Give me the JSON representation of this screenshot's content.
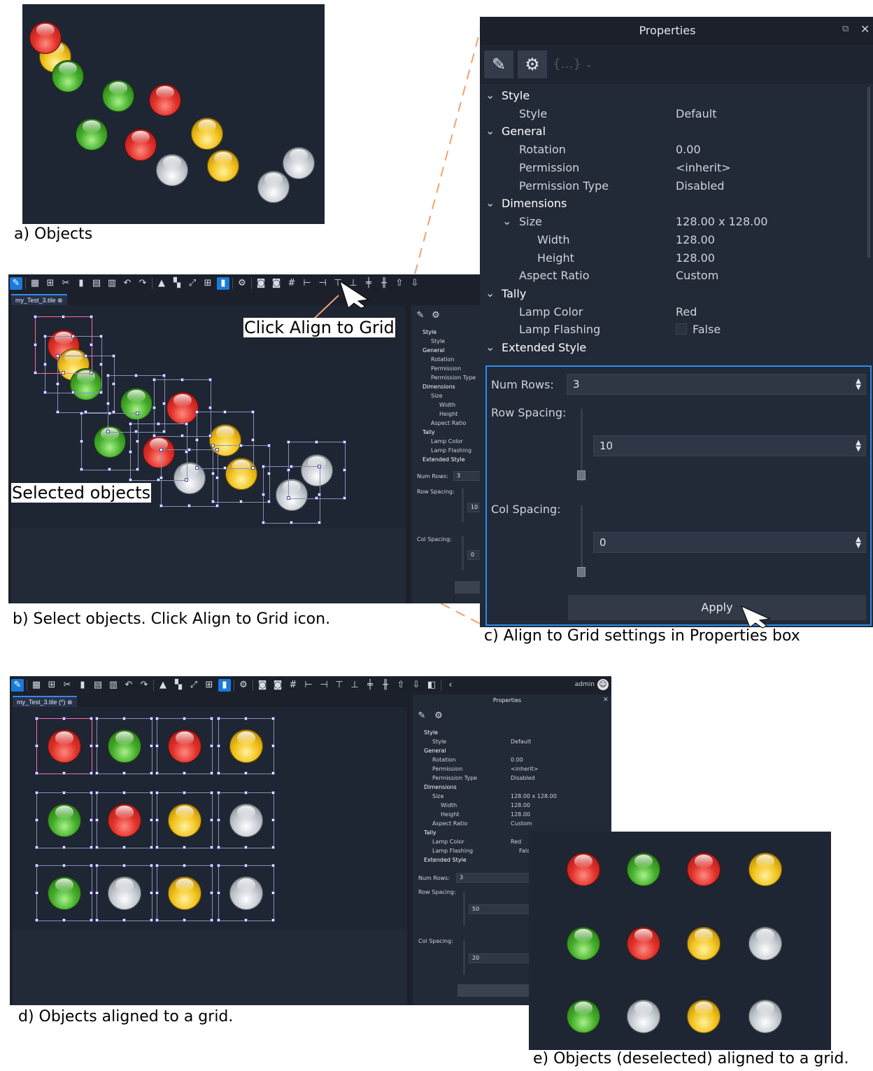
{
  "captions": {
    "a": "a) Objects",
    "b": "b) Select objects. Click Align to Grid icon.",
    "c": "c) Align to Grid settings in Properties box",
    "d": "d) Objects aligned to a grid.",
    "e": "e) Objects (deselected) aligned to a grid."
  },
  "callouts": {
    "click_align": "Click Align to Grid",
    "selected_objects": "Selected objects"
  },
  "editor": {
    "tab_b": "my_Test_3.tile",
    "tab_d": "my_Test_3.tile (*)",
    "user": "admin",
    "toolbar_icons": [
      "edit-icon",
      "grid-view-icon",
      "tile-view-icon",
      "cut-icon",
      "copy-icon",
      "paste-icon",
      "delete-icon",
      "undo-icon",
      "redo-icon",
      "lock-icon",
      "group-icon",
      "resize-icon",
      "table-icon",
      "chart-icon",
      "gear-icon",
      "snapshot-icon",
      "snapshot2-icon",
      "align-to-grid-icon",
      "align-left-icon",
      "align-center-icon",
      "align-top-icon",
      "align-bottom-icon",
      "distribute-h-icon",
      "distribute-v-icon",
      "bring-front-icon",
      "send-back-icon",
      "split-icon",
      "nav-left-icon"
    ]
  },
  "properties": {
    "title": "Properties",
    "sections": {
      "style": "Style",
      "general": "General",
      "dimensions": "Dimensions",
      "size": "Size",
      "tally": "Tally",
      "extended": "Extended Style"
    },
    "rows": {
      "style_label": "Style",
      "style_value": "Default",
      "rotation_label": "Rotation",
      "rotation_value": "0.00",
      "permission_label": "Permission",
      "permission_value": "<inherit>",
      "permission_type_label": "Permission Type",
      "permission_type_value": "Disabled",
      "size_value": "128.00 x 128.00",
      "width_label": "Width",
      "width_value": "128.00",
      "height_label": "Height",
      "height_value": "128.00",
      "aspect_label": "Aspect Ratio",
      "aspect_value": "Custom",
      "lamp_color_label": "Lamp Color",
      "lamp_color_value": "Red",
      "lamp_flashing_label": "Lamp Flashing",
      "lamp_flashing_value": "False"
    },
    "grid": {
      "num_rows_label": "Num Rows:",
      "num_rows_value": "3",
      "row_spacing_label": "Row Spacing:",
      "row_spacing_value": "10",
      "col_spacing_label": "Col Spacing:",
      "col_spacing_value": "0",
      "apply_label": "Apply"
    },
    "grid_d": {
      "row_spacing_value": "50",
      "col_spacing_value": "20"
    }
  },
  "colors": {
    "canvas": "#1e2533",
    "panel": "#222937",
    "highlight_box": "#2a8cf0",
    "leader_line": "#f0a070"
  }
}
